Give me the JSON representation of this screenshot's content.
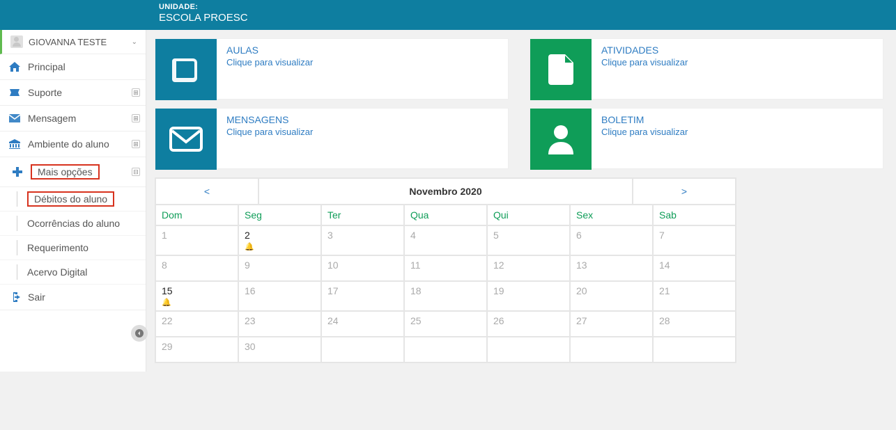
{
  "topbar": {
    "label": "UNIDADE:",
    "title": "ESCOLA PROESC"
  },
  "user": {
    "name": "GIOVANNA TESTE"
  },
  "nav": {
    "principal": "Principal",
    "suporte": "Suporte",
    "mensagem": "Mensagem",
    "ambiente": "Ambiente do aluno",
    "mais_opcoes": "Mais opções",
    "debitos": "Débitos do aluno",
    "ocorrencias": "Ocorrências do aluno",
    "requerimento": "Requerimento",
    "acervo": "Acervo Digital",
    "sair": "Sair"
  },
  "cards": {
    "aulas": {
      "title": "AULAS",
      "sub": "Clique para visualizar"
    },
    "atividades": {
      "title": "ATIVIDADES",
      "sub": "Clique para visualizar"
    },
    "mensagens": {
      "title": "MENSAGENS",
      "sub": "Clique para visualizar"
    },
    "boletim": {
      "title": "BOLETIM",
      "sub": "Clique para visualizar"
    }
  },
  "calendar": {
    "prev": "<",
    "next": ">",
    "title": "Novembro 2020",
    "days": [
      "Dom",
      "Seg",
      "Ter",
      "Qua",
      "Qui",
      "Sex",
      "Sab"
    ],
    "weeks": [
      [
        {
          "n": "1",
          "dim": true
        },
        {
          "n": "2",
          "today": true,
          "bell": true
        },
        {
          "n": "3",
          "dim": true
        },
        {
          "n": "4",
          "dim": true
        },
        {
          "n": "5",
          "dim": true
        },
        {
          "n": "6",
          "dim": true
        },
        {
          "n": "7",
          "dim": true
        }
      ],
      [
        {
          "n": "8",
          "dim": true
        },
        {
          "n": "9",
          "dim": true
        },
        {
          "n": "10",
          "dim": true
        },
        {
          "n": "11",
          "dim": true
        },
        {
          "n": "12",
          "dim": true
        },
        {
          "n": "13",
          "dim": true
        },
        {
          "n": "14",
          "dim": true
        }
      ],
      [
        {
          "n": "15",
          "today": true,
          "bell": true
        },
        {
          "n": "16",
          "dim": true
        },
        {
          "n": "17",
          "dim": true
        },
        {
          "n": "18",
          "dim": true
        },
        {
          "n": "19",
          "dim": true
        },
        {
          "n": "20",
          "dim": true
        },
        {
          "n": "21",
          "dim": true
        }
      ],
      [
        {
          "n": "22",
          "dim": true
        },
        {
          "n": "23",
          "dim": true
        },
        {
          "n": "24",
          "dim": true
        },
        {
          "n": "25",
          "dim": true
        },
        {
          "n": "26",
          "dim": true
        },
        {
          "n": "27",
          "dim": true
        },
        {
          "n": "28",
          "dim": true
        }
      ],
      [
        {
          "n": "29",
          "dim": true
        },
        {
          "n": "30",
          "dim": true
        },
        {
          "n": ""
        },
        {
          "n": ""
        },
        {
          "n": ""
        },
        {
          "n": ""
        },
        {
          "n": ""
        }
      ]
    ]
  }
}
